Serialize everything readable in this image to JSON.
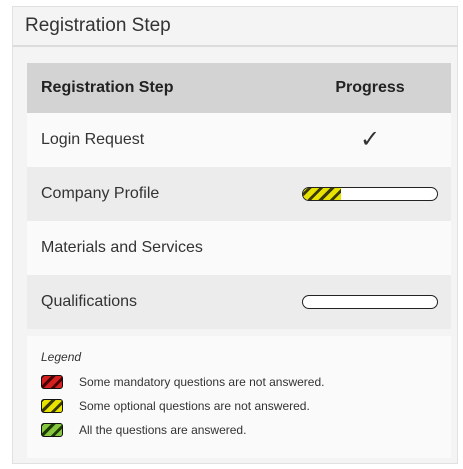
{
  "panel": {
    "title": "Registration Step"
  },
  "table": {
    "headers": {
      "step": "Registration Step",
      "progress": "Progress"
    },
    "rows": [
      {
        "label": "Login Request",
        "status": "complete",
        "check_glyph": "✓"
      },
      {
        "label": "Company Profile",
        "status": "partial",
        "progress_fraction": 0.28,
        "progress_color": "yellow"
      },
      {
        "label": "Materials and Services",
        "status": "none"
      },
      {
        "label": "Qualifications",
        "status": "empty",
        "progress_fraction": 0.0
      }
    ]
  },
  "legend": {
    "title": "Legend",
    "items": [
      {
        "color": "#d42020",
        "icon": "red-striped-swatch",
        "text": "Some mandatory questions are not answered."
      },
      {
        "color": "#e7e200",
        "icon": "yellow-striped-swatch",
        "text": "Some optional questions are not answered."
      },
      {
        "color": "#86c540",
        "icon": "green-striped-swatch",
        "text": "All the questions are answered."
      }
    ]
  }
}
